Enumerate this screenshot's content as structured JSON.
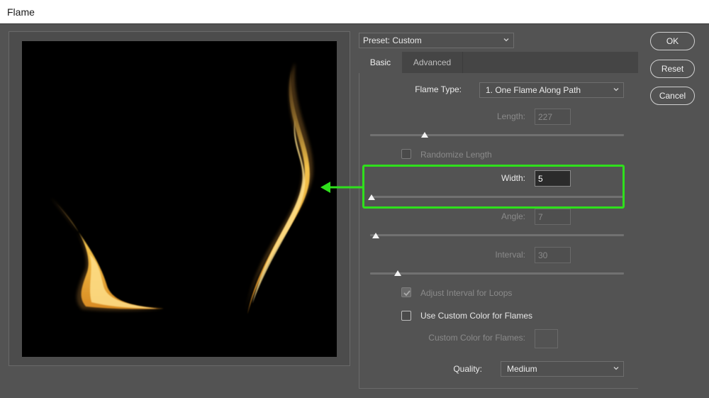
{
  "window": {
    "title": "Flame"
  },
  "preset": {
    "label": "Preset: Custom"
  },
  "tabs": [
    {
      "label": "Basic"
    },
    {
      "label": "Advanced"
    }
  ],
  "basic": {
    "flame_type": {
      "label": "Flame Type:",
      "value": "1. One Flame Along Path"
    },
    "length": {
      "label": "Length:",
      "value": "227",
      "slider": 0.21
    },
    "randomize_length": {
      "label": "Randomize Length",
      "checked": false
    },
    "width": {
      "label": "Width:",
      "value": "5",
      "slider": 0.0
    },
    "angle": {
      "label": "Angle:",
      "value": "7",
      "slider": 0.02
    },
    "interval": {
      "label": "Interval:",
      "value": "30",
      "slider": 0.11
    },
    "adjust_interval": {
      "label": "Adjust Interval for Loops",
      "checked": true
    },
    "custom_color": {
      "label": "Use Custom Color for Flames",
      "checked": false
    },
    "custom_color_swatch": {
      "label": "Custom Color for Flames:"
    },
    "quality": {
      "label": "Quality:",
      "value": "Medium"
    }
  },
  "buttons": {
    "ok": "OK",
    "reset": "Reset",
    "cancel": "Cancel"
  },
  "colors": {
    "highlight": "#2fe01c",
    "panel": "#535353",
    "flame": "#f5c44a"
  }
}
